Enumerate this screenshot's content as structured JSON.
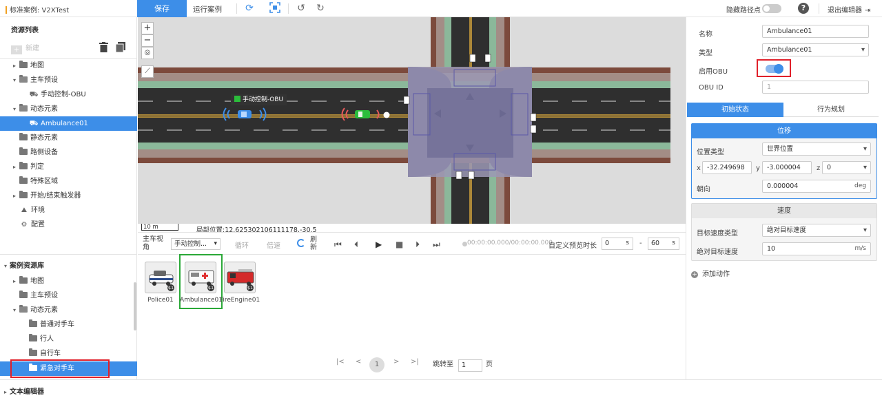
{
  "topbar": {
    "case_title": "标准案例: V2XTest",
    "save_label": "保存",
    "run_label": "运行案例",
    "hide_path_label": "隐藏路径点",
    "help_symbol": "?",
    "exit_label": "退出编辑器"
  },
  "resource_list": {
    "title": "资源列表",
    "new_label": "新建",
    "items": [
      {
        "label": "地图",
        "icon": "folder-icon",
        "caret": "▸"
      },
      {
        "label": "主车预设",
        "icon": "folder-open-icon",
        "caret": "▾"
      },
      {
        "label": "手动控制-OBU",
        "icon": "car-icon"
      },
      {
        "label": "动态元素",
        "icon": "folder-open-icon",
        "caret": "▾"
      },
      {
        "label": "Ambulance01",
        "icon": "car-icon"
      },
      {
        "label": "静态元素",
        "icon": "folder-icon"
      },
      {
        "label": "路侧设备",
        "icon": "folder-icon"
      },
      {
        "label": "判定",
        "icon": "folder-icon",
        "caret": "▸"
      },
      {
        "label": "特殊区域",
        "icon": "folder-icon"
      },
      {
        "label": "开始/结束触发器",
        "icon": "folder-icon",
        "caret": "▸"
      },
      {
        "label": "环境",
        "icon": "environment-icon"
      },
      {
        "label": "配置",
        "icon": "config-icon"
      }
    ]
  },
  "case_library": {
    "title": "案例资源库",
    "items": [
      {
        "label": "地图",
        "icon": "folder-icon",
        "caret": "▸"
      },
      {
        "label": "主车预设",
        "icon": "folder-icon"
      },
      {
        "label": "动态元素",
        "icon": "folder-open-icon",
        "caret": "▾"
      },
      {
        "label": "普通对手车",
        "icon": "folder-icon"
      },
      {
        "label": "行人",
        "icon": "folder-icon"
      },
      {
        "label": "自行车",
        "icon": "folder-icon"
      },
      {
        "label": "紧急对手车",
        "icon": "folder-icon"
      }
    ]
  },
  "text_editor_label": "文本编辑器",
  "map": {
    "zoom_in": "+",
    "zoom_out": "−",
    "ego_label": "手动控制-OBU",
    "scale_label": "10 m",
    "local_position": "局部位置:12.625302106111178,-30.5"
  },
  "player": {
    "view_label": "主车视角",
    "view_value": "手动控制...",
    "loop_label": "循环",
    "speed_label": "倍速",
    "refresh_label": "刷新",
    "time_display": "00:00:00.000/00:00:00.000",
    "preview_label": "自定义预览时长",
    "start_value": "0",
    "start_unit": "s",
    "dash": "-",
    "end_value": "60",
    "end_unit": "s"
  },
  "assets": [
    {
      "label": "Police01",
      "badge": "$1"
    },
    {
      "label": "Ambulance01",
      "badge": "$1"
    },
    {
      "label": "FireEngine01",
      "badge": "$1"
    }
  ],
  "pagination": {
    "first": "|<",
    "prev": "<",
    "current": "1",
    "next": ">",
    "last": ">|",
    "goto_label": "跳转至",
    "goto_value": "1",
    "page_unit": "页"
  },
  "properties": {
    "name_label": "名称",
    "name_value": "Ambulance01",
    "type_label": "类型",
    "type_value": "Ambulance01",
    "obu_label": "启用OBU",
    "obu_enabled": true,
    "obu_id_label": "OBU ID",
    "obu_id_value": "1"
  },
  "tabs": {
    "initial": "初始状态",
    "behavior": "行为规划"
  },
  "position": {
    "title": "位移",
    "pos_type_label": "位置类型",
    "pos_type_value": "世界位置",
    "x_label": "x",
    "x_value": "-32.249698",
    "y_label": "y",
    "y_value": "-3.000004",
    "z_label": "z",
    "z_value": "0",
    "heading_label": "朝向",
    "heading_value": "0.000004",
    "heading_unit": "deg"
  },
  "speed": {
    "title": "速度",
    "target_type_label": "目标速度类型",
    "target_type_value": "绝对目标速度",
    "abs_speed_label": "绝对目标速度",
    "abs_speed_value": "10",
    "abs_speed_unit": "m/s"
  },
  "add_action_label": "添加动作",
  "colors": {
    "accent": "#3d8ee8",
    "highlight_red": "#e0202a",
    "highlight_green": "#2aa837"
  }
}
